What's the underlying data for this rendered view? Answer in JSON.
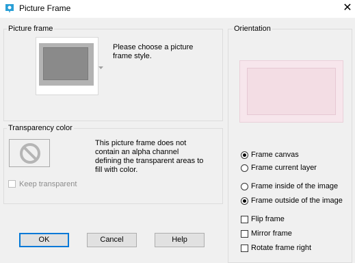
{
  "window": {
    "title": "Picture Frame",
    "close_glyph": "✕"
  },
  "picture_frame": {
    "label": "Picture frame",
    "instruction_line1": "Please choose a picture",
    "instruction_line2": "frame style."
  },
  "transparency": {
    "label": "Transparency color",
    "message_line1": "This picture frame does not",
    "message_line2": "contain an alpha channel",
    "message_line3": "defining the transparent areas to",
    "message_line4": "fill with color.",
    "keep_transparent_label": "Keep transparent",
    "keep_transparent_checked": false,
    "keep_transparent_enabled": false
  },
  "orientation": {
    "label": "Orientation",
    "frame_canvas": "Frame canvas",
    "frame_current_layer": "Frame current layer",
    "frame_inside": "Frame inside of the image",
    "frame_outside": "Frame outside of the image",
    "flip_frame": "Flip frame",
    "mirror_frame": "Mirror frame",
    "rotate_frame_right": "Rotate frame right",
    "selected_target": "Frame canvas",
    "selected_placement": "Frame outside of the image",
    "flip_checked": false,
    "mirror_checked": false,
    "rotate_checked": false
  },
  "buttons": {
    "ok": "OK",
    "cancel": "Cancel",
    "help": "Help"
  },
  "icons": {
    "app": "picture-frame-app-icon",
    "no_color": "prohibited-icon",
    "dropdown": "dropdown-arrow-icon"
  },
  "colors": {
    "accent": "#0078d7",
    "frame_grey": "#8a8a8a",
    "preview_pink": "#f3dde4"
  }
}
